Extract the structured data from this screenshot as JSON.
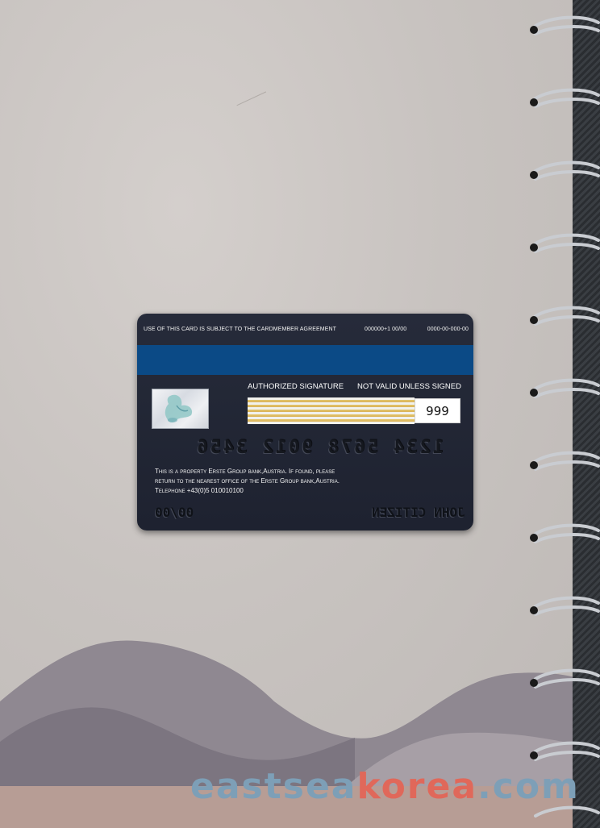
{
  "card": {
    "agreement_text": "USE OF THIS CARD IS SUBJECT TO THE CARDMEMBER AGREEMENT",
    "code_a": "000000+1 00/00",
    "code_b": "0000-00-000-00",
    "signature_label": "AUTHORIZED SIGNATURE",
    "not_valid_label": "NOT VALID UNLESS SIGNED",
    "cvv": "999",
    "card_number": "1234 5678 9012 3456",
    "property_line1": "This is a property Erste Group bank,Austria. If found, please",
    "property_line2": "return to the nearest office of the Erste Group bank,Austria.",
    "property_line3": "Telephone  +43(0)5 010010100",
    "expiry": "00/00",
    "cardholder": "JOHN CITIZEN",
    "stripe_color": "#0b4a86",
    "body_color": "#262b3a"
  },
  "watermark": {
    "part1": "eastsea",
    "part2": "korea",
    "part3": ".com",
    "color1": "#7d9fb7",
    "color2": "#e0685a",
    "color3": "#7d9fb7"
  }
}
